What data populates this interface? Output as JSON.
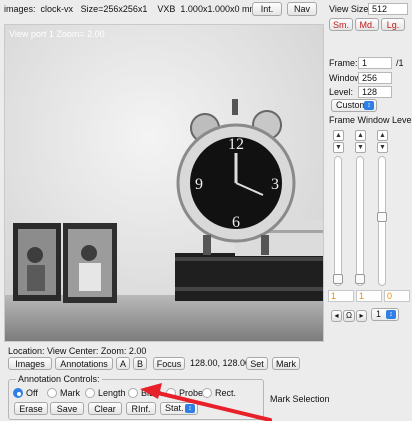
{
  "info_bar": {
    "images_label": "images:",
    "image_name": "clock-vx",
    "size": "Size=256x256x1",
    "vxb": "VXB",
    "voxel": "1.000x1.000x0 mm",
    "int_button": "Int.",
    "nav_button": "Nav"
  },
  "viewport": {
    "label": "View port 1 Zoom= 2.00"
  },
  "right_panel": {
    "view_size_label": "View Size:",
    "view_size_value": "512",
    "sm_button": "Sm.",
    "md_button": "Md.",
    "lg_button": "Lg.",
    "frame_label": "Frame:",
    "frame_value": "1",
    "frame_total": "/1",
    "window_label": "Window:",
    "window_value": "256",
    "level_label": "Level:",
    "level_value": "128",
    "custom_select": "Custom",
    "fwl_label": "Frame Window Level",
    "slider_values": [
      "1",
      "1",
      "0"
    ],
    "nav_prev": "◂",
    "nav_loop": "Ω",
    "nav_next": "▸",
    "frame_select": "1"
  },
  "location": {
    "text": "Location:  View Center:  Zoom: 2.00",
    "images_button": "Images",
    "annotations_button": "Annotations",
    "a_button": "A",
    "b_button": "B",
    "focus_button": "Focus",
    "coords": "128.00, 128.00",
    "set_button": "Set",
    "mark_button": "Mark"
  },
  "annotation_controls": {
    "legend": "Annotation Controls:",
    "radios": [
      "Off",
      "Mark",
      "Length",
      "BiDir.",
      "Probe",
      "Rect."
    ],
    "selected": "Off",
    "erase": "Erase",
    "save": "Save",
    "clear": "Clear",
    "rinf": "RInf.",
    "stat": "Stat.",
    "mark_selection": "Mark Selection"
  },
  "colors": {
    "accent": "#2f7fe6",
    "red_text": "#c41a1a",
    "orange_text": "#e09000",
    "arrow": "#e8202a"
  }
}
